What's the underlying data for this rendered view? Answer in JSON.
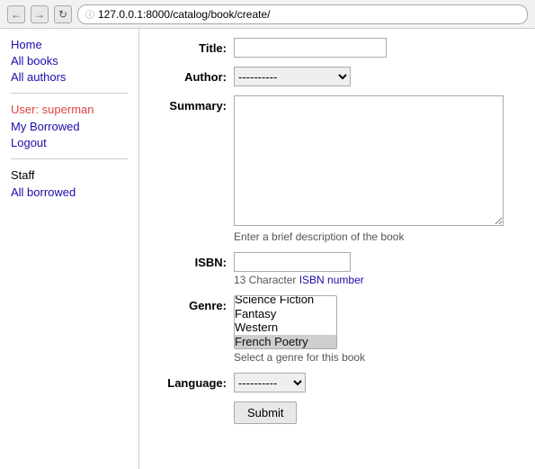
{
  "browser": {
    "url": "127.0.0.1:8000/catalog/book/create/",
    "back_label": "←",
    "forward_label": "→",
    "reload_label": "↻"
  },
  "sidebar": {
    "home_label": "Home",
    "all_books_label": "All books",
    "all_authors_label": "All authors",
    "user_text": "User: ",
    "username": "superman",
    "my_borrowed_label": "My Borrowed",
    "logout_label": "Logout",
    "staff_label": "Staff",
    "all_borrowed_label": "All borrowed"
  },
  "form": {
    "title_label": "Title:",
    "author_label": "Author:",
    "author_default": "----------",
    "summary_label": "Summary:",
    "summary_hint": "Enter a brief description of the book",
    "isbn_label": "ISBN:",
    "isbn_hint_prefix": "13 Character ",
    "isbn_hint_link": "ISBN number",
    "genre_label": "Genre:",
    "genre_options": [
      "Science Fiction",
      "Fantasy",
      "Western",
      "French Poetry"
    ],
    "genre_hint": "Select a genre for this book",
    "language_label": "Language:",
    "language_default": "----------",
    "submit_label": "Submit"
  }
}
